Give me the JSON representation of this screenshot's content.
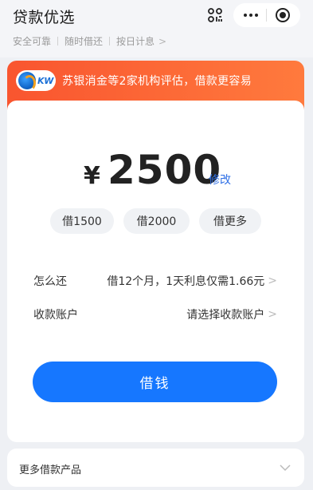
{
  "header": {
    "title": "贷款优选",
    "tags": [
      "安全可靠",
      "随时借还",
      "按日计息"
    ]
  },
  "banner": {
    "logo_text": "KW",
    "text": "苏银消金等2家机构评估，借款更容易"
  },
  "loan": {
    "currency": "¥",
    "amount": "2500",
    "edit_label": "修改",
    "chips": [
      "借1500",
      "借2000",
      "借更多"
    ]
  },
  "rows": {
    "repay_label": "怎么还",
    "repay_value": "借12个月，1天利息仅需1.66元",
    "account_label": "收款账户",
    "account_value": "请选择收款账户"
  },
  "cta_label": "借钱",
  "more": {
    "label": "更多借款产品"
  },
  "colors": {
    "primary": "#1677ff",
    "banner_start": "#f9552f",
    "banner_end": "#ff7a3d",
    "link": "#2e6fe6"
  },
  "icons": [
    "scan-icon",
    "more-dots-icon",
    "target-icon",
    "chevron-right-icon",
    "chevron-down-icon"
  ]
}
